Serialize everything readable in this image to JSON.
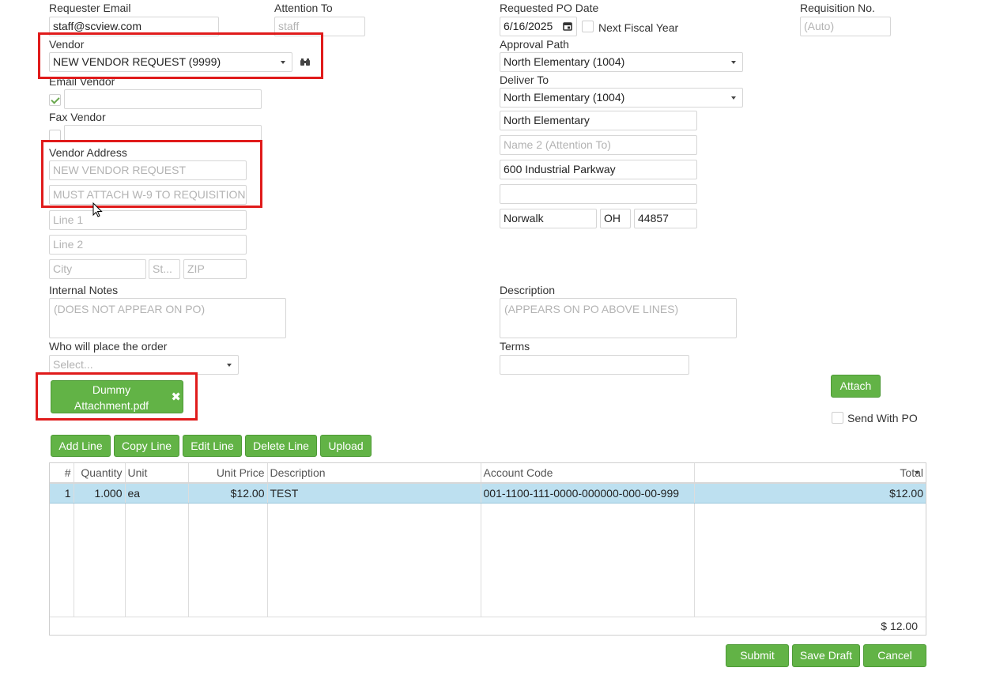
{
  "requester": {
    "label": "Requester Email",
    "value": "staff@scview.com"
  },
  "attention": {
    "label": "Attention To",
    "placeholder": "staff"
  },
  "vendor": {
    "label": "Vendor",
    "value": "NEW VENDOR REQUEST (9999)"
  },
  "email_vendor": {
    "label": "Email Vendor"
  },
  "fax_vendor": {
    "label": "Fax Vendor"
  },
  "vendor_address": {
    "label": "Vendor Address",
    "line_a": "NEW VENDOR REQUEST",
    "line_b": "MUST ATTACH W-9 TO REQUISITION",
    "line1_ph": "Line 1",
    "line2_ph": "Line 2",
    "city_ph": "City",
    "state_ph": "St...",
    "zip_ph": "ZIP"
  },
  "internal_notes": {
    "label": "Internal Notes",
    "placeholder": "(DOES NOT APPEAR ON PO)"
  },
  "who_places": {
    "label": "Who will place the order",
    "value": "Select..."
  },
  "attachment": {
    "name_line1": "Dummy",
    "name_line2": "Attachment.pdf"
  },
  "po_date": {
    "label": "Requested PO Date",
    "value": "6/16/2025"
  },
  "next_fiscal": {
    "label": "Next Fiscal Year"
  },
  "requisition": {
    "label": "Requisition No.",
    "placeholder": "(Auto)"
  },
  "approval_path": {
    "label": "Approval Path",
    "value": "North Elementary (1004)"
  },
  "deliver_to": {
    "label": "Deliver To",
    "value": "North Elementary (1004)",
    "name": "North Elementary",
    "name2_ph": "Name 2 (Attention To)",
    "address1": "600 Industrial Parkway",
    "address2": "",
    "city": "Norwalk",
    "state": "OH",
    "zip": "44857"
  },
  "description": {
    "label": "Description",
    "placeholder": "(APPEARS ON PO ABOVE LINES)"
  },
  "terms": {
    "label": "Terms"
  },
  "attach_button": "Attach",
  "send_with_po": "Send With PO",
  "line_buttons": {
    "add": "Add Line",
    "copy": "Copy Line",
    "edit": "Edit Line",
    "delete": "Delete Line",
    "upload": "Upload"
  },
  "table": {
    "headers": {
      "num": "#",
      "qty": "Quantity",
      "unit": "Unit",
      "price": "Unit Price",
      "desc": "Description",
      "acct": "Account Code",
      "total": "Total"
    },
    "rows": [
      {
        "num": "1",
        "qty": "1.000",
        "unit": "ea",
        "price": "$12.00",
        "desc": "TEST",
        "acct": "001-1100-111-0000-000000-000-00-999",
        "total": "$12.00"
      }
    ],
    "grand_total": "$ 12.00"
  },
  "footer_buttons": {
    "submit": "Submit",
    "save": "Save Draft",
    "cancel": "Cancel"
  },
  "colors": {
    "button_green": "#62b346",
    "highlight_red": "#e01b1b",
    "selected_row": "#bde0f0"
  }
}
